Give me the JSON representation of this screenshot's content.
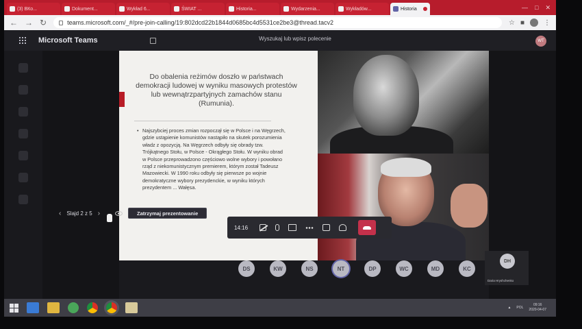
{
  "browser": {
    "tabs": [
      {
        "label": "(3) ВКо..."
      },
      {
        "label": "Dokument..."
      },
      {
        "label": "Wykład 6..."
      },
      {
        "label": "ŚWIAT ..."
      },
      {
        "label": "Historia..."
      },
      {
        "label": "Wydarzenia..."
      },
      {
        "label": "Wykładów..."
      }
    ],
    "active_tab": "Historia",
    "url": "teams.microsoft.com/_#/pre-join-calling/19:802dcd22b1844d0685bc4d5531ce2be3@thread.tacv2"
  },
  "teams": {
    "app_title": "Microsoft Teams",
    "search_placeholder": "Wyszukaj lub wpisz polecenie",
    "me_initials": "WT"
  },
  "slide": {
    "title": "Do obalenia reżimów doszło w państwach demokracji ludowej w wyniku masowych protestów lub wewnątrzpartyjnych zamachów stanu (Rumunia).",
    "bullet": "Najszybciej proces zmian rozpoczął się w Polsce i na Węgrzech, gdzie ustąpienie komunistów nastąpiło na skutek porozumienia władz z opozycją. Na Węgrzech odbyły się obrady tzw. Trójkątnego Stołu, w Polsce - Okrągłego Stołu. W wyniku obrad w Polsce przeprowadzono częściowo wolne wybory i powołano rząd z niekomunistycznym premierem, którym został Tadeusz Mazowiecki. W 1990 roku odbyły się pierwsze po wojnie demokratyczne wybory prezydenckie, w wyniku których prezydentem ... Wałęsa."
  },
  "presentation": {
    "slide_counter": "Slajd 2 z 5",
    "stop_label": "Zatrzymaj prezentowanie"
  },
  "call": {
    "time": "14:16"
  },
  "participants": [
    "DS",
    "KW",
    "NS",
    "NT",
    "DP",
    "WC",
    "MD",
    "KC"
  ],
  "speaking": "NT",
  "self": {
    "initials": "DH",
    "name": "Daria Hryshchenko"
  },
  "taskbar": {
    "clock_time": "09:16",
    "clock_date": "2020-04-07",
    "lang": "POL"
  },
  "colors": {
    "tabstrip": "#b71c2c",
    "teams_accent": "#6264a7",
    "hangup": "#c4314b",
    "slide_accent": "#b81c26"
  }
}
